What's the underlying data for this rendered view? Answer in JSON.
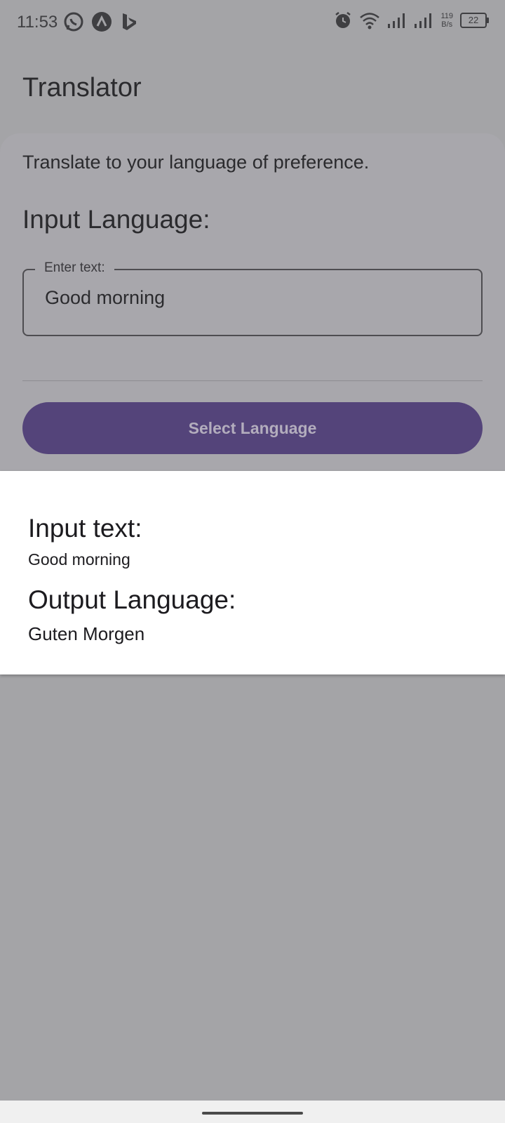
{
  "status_bar": {
    "time": "11:53",
    "icons_left": [
      "whatsapp-icon",
      "app-a-icon",
      "bing-icon"
    ],
    "icons_right": [
      "alarm-icon",
      "wifi-icon",
      "signal-icon",
      "signal-icon"
    ],
    "network_speed_value": "119",
    "network_speed_unit": "B/s",
    "battery": "22"
  },
  "app": {
    "title": "Translator"
  },
  "main": {
    "subtitle": "Translate to your language of preference.",
    "input_heading": "Input Language:",
    "text_field": {
      "label": "Enter text:",
      "value": "Good morning"
    },
    "select_button": "Select Language"
  },
  "result": {
    "input_heading": "Input text:",
    "input_value": "Good morning",
    "output_heading": "Output Language:",
    "output_value": "Guten Morgen"
  },
  "colors": {
    "scrim": "#a4a4a7",
    "primary_button": "#54447a",
    "panel": "#ffffff"
  }
}
